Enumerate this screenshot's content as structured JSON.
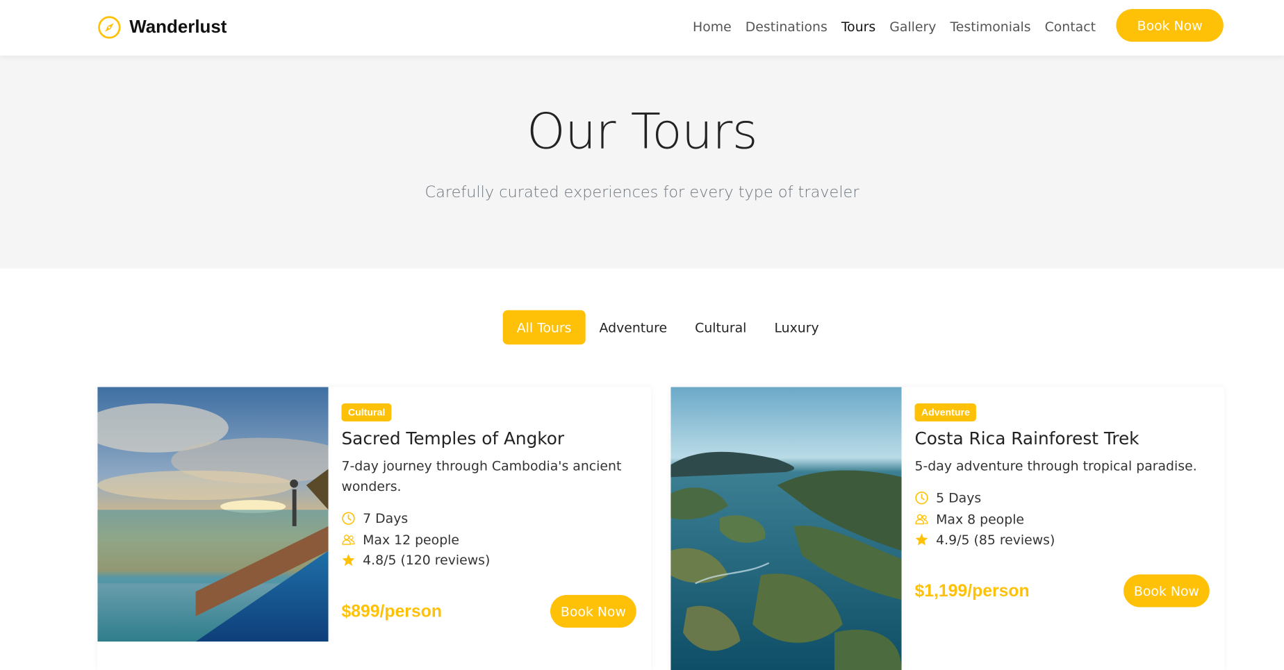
{
  "brand": {
    "name": "Wanderlust",
    "icon": "compass-icon"
  },
  "nav": {
    "links": [
      {
        "label": "Home"
      },
      {
        "label": "Destinations"
      },
      {
        "label": "Tours",
        "active": true
      },
      {
        "label": "Gallery"
      },
      {
        "label": "Testimonials"
      },
      {
        "label": "Contact"
      }
    ],
    "cta_label": "Book Now"
  },
  "hero": {
    "title": "Our Tours",
    "subtitle": "Carefully curated experiences for every type of traveler"
  },
  "filters": [
    {
      "label": "All Tours",
      "active": true
    },
    {
      "label": "Adventure"
    },
    {
      "label": "Cultural"
    },
    {
      "label": "Luxury"
    }
  ],
  "tours": [
    {
      "badge": "Cultural",
      "title": "Sacred Temples of Angkor",
      "description": "7-day journey through Cambodia's ancient wonders.",
      "duration": "7 Days",
      "group": "Max 12 people",
      "rating": "4.8/5 (120 reviews)",
      "price": "$899/person",
      "cta": "Book Now",
      "image": "sunset-pool-ocean-photo"
    },
    {
      "badge": "Adventure",
      "title": "Costa Rica Rainforest Trek",
      "description": "5-day adventure through tropical paradise.",
      "duration": "5 Days",
      "group": "Max 8 people",
      "rating": "4.9/5 (85 reviews)",
      "price": "$1,199/person",
      "cta": "Book Now",
      "image": "aerial-islands-lagoon-photo"
    }
  ],
  "colors": {
    "accent": "#FFC107",
    "hero_bg": "#f5f5f6",
    "text": "#222222"
  }
}
